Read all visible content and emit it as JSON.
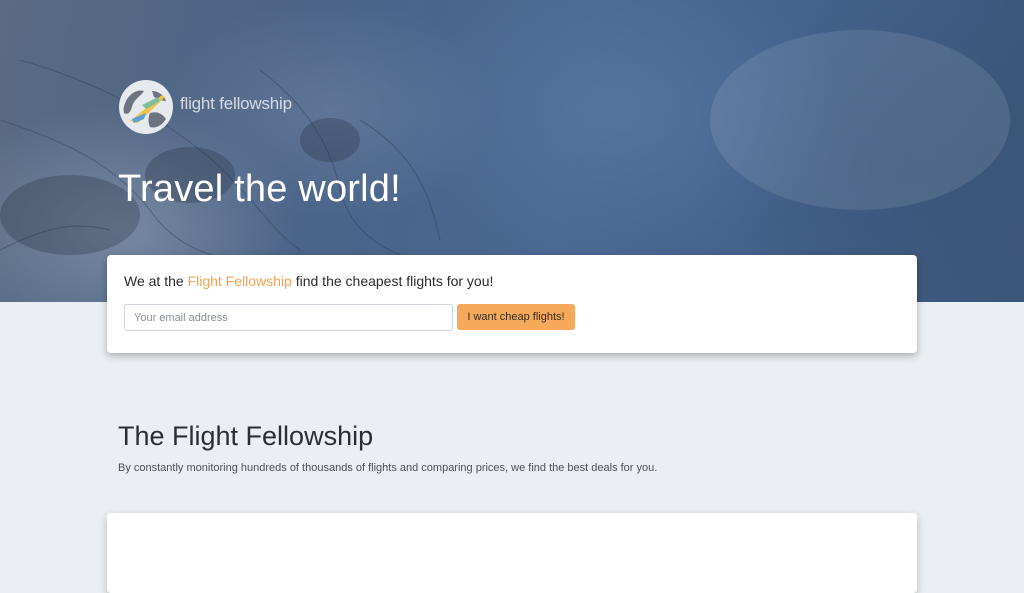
{
  "brand": {
    "name": "flight fellowship"
  },
  "hero": {
    "title": "Travel the world!"
  },
  "signup": {
    "intro_before": "We at the",
    "intro_highlight": "Flight Fellowship",
    "intro_after": "find the cheapest flights for you!",
    "email_placeholder": "Your email address",
    "email_value": "",
    "button_label": "I want cheap flights!"
  },
  "about": {
    "title": "The Flight Fellowship",
    "description": "By constantly monitoring hundreds of thousands of flights and comparing prices, we find the best deals for you."
  },
  "colors": {
    "accent": "#f4a353",
    "button": "#f6a95a",
    "hero_blue": "#4a6892",
    "page_bg": "#ebeff3"
  },
  "icons": [
    "logo-globe-plane-icon"
  ]
}
